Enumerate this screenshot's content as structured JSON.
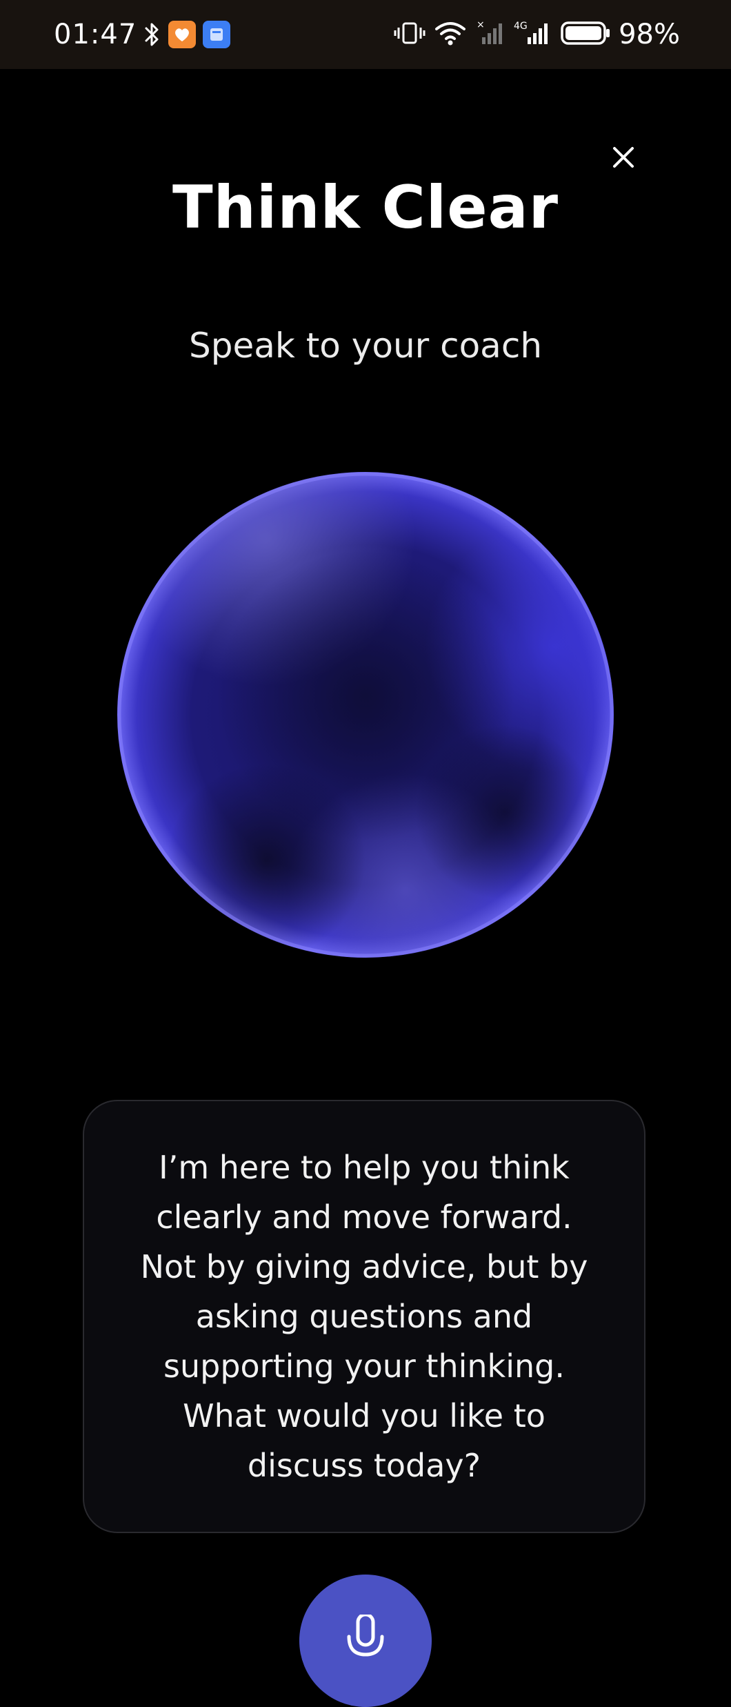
{
  "status_bar": {
    "time": "01:47",
    "battery_percent": "98%",
    "network": "4G",
    "icons": [
      "bluetooth-icon",
      "app-orange-icon",
      "app-blue-icon",
      "vibrate-icon",
      "wifi-icon",
      "signal-icon",
      "signal-4g-icon",
      "battery-icon"
    ]
  },
  "screen": {
    "title": "Think Clear",
    "subtitle": "Speak to your coach",
    "close_icon": "close-icon",
    "message": "I’m here to help you think\nclearly and move forward.\nNot by giving advice, but by\nasking questions and\nsupporting your thinking.\nWhat would you like to\ndiscuss today?",
    "mic_icon": "microphone-icon"
  },
  "colors": {
    "background": "#000000",
    "status_bar": "#18130f",
    "orb_primary": "#3a33c8",
    "orb_dark": "#14124a",
    "card_background": "#0b0b0f",
    "card_border": "#2a2a2f",
    "mic_button": "#4b52c4"
  }
}
